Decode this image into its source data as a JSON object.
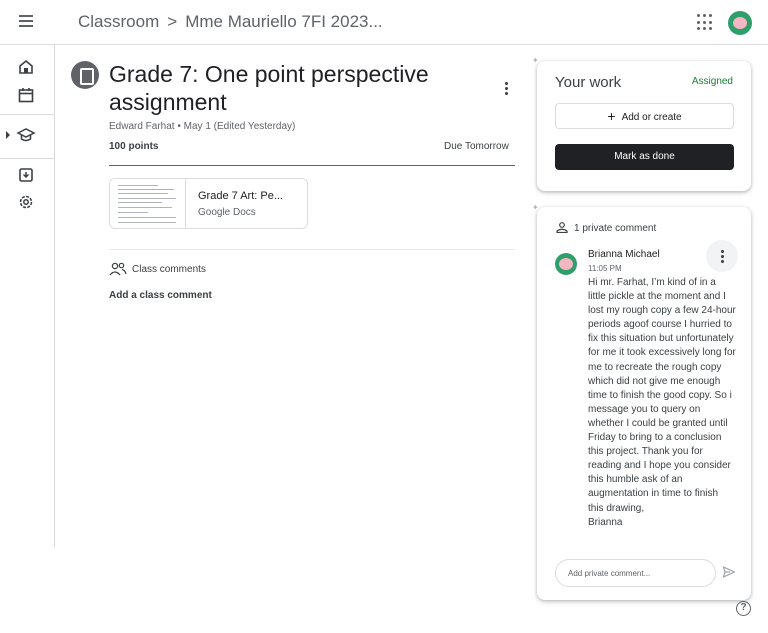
{
  "header": {
    "app_name": "Classroom",
    "separator": ">",
    "class_name": "Mme Mauriello 7FI 2023..."
  },
  "rail": {
    "items": [
      "home-icon",
      "calendar-icon",
      "enrolled-icon",
      "todo-icon",
      "settings-icon"
    ]
  },
  "assignment": {
    "title": "Grade 7: One point perspective assignment",
    "meta": "Edward Farhat • May 1 (Edited Yesterday)",
    "points": "100 points",
    "due": "Due Tomorrow",
    "attachment": {
      "title": "Grade 7 Art: Pe...",
      "type": "Google Docs"
    },
    "class_comments_label": "Class comments",
    "add_class_comment": "Add a class comment"
  },
  "your_work": {
    "title": "Your work",
    "status": "Assigned",
    "status_color": "#188038",
    "add_label": "Add or create",
    "mark_done_label": "Mark as done"
  },
  "private_comments": {
    "header": "1 private comment",
    "comment": {
      "author": "Brianna Michael",
      "time": "11:05 PM",
      "text": "Hi mr. Farhat, I’m kind of in a little pickle at the moment and I lost my rough copy a few 24-hour periods agoof course I hurried to fix this situation but unfortunately for me it took excessively long for me to recreate the rough copy which did not give me enough time to finish the good copy. So i message you to query on whether I could be granted until Friday to bring to a conclusion this project. Thank you for reading and I hope you consider this humble ask of an augmentation in time to finish this drawing,\nBrianna"
    },
    "input_placeholder": "Add private comment..."
  },
  "help_label": "?"
}
